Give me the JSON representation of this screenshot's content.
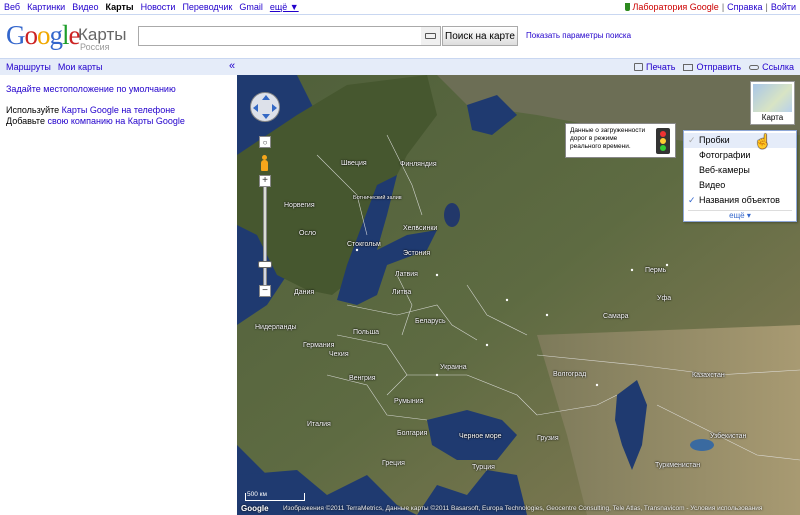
{
  "topnav": {
    "items": [
      "Веб",
      "Картинки",
      "Видео",
      "Карты",
      "Новости",
      "Переводчик",
      "Gmail",
      "ещё ▼"
    ],
    "lab": "Лаборатория Google",
    "help": "Справка",
    "signin": "Войти",
    "sep": "|"
  },
  "header": {
    "logo": "Google",
    "product": "Карты",
    "country": "Россия",
    "search_value": "",
    "search_button": "Поиск на карте",
    "search_options": "Показать параметры поиска"
  },
  "bar": {
    "routes": "Маршруты",
    "my_maps": "Мои карты",
    "collapse": "«",
    "print": "Печать",
    "send": "Отправить",
    "link": "Ссылка"
  },
  "left": {
    "set_location": "Задайте местоположение по умолчанию",
    "line1_prefix": "Используйте ",
    "line1_link": "Карты Google на телефоне",
    "line2_prefix": "Добавьте ",
    "line2_link": "свою компанию на Карты Google"
  },
  "map": {
    "type_label": "Карта",
    "zoom_center": "○",
    "zoom_in": "+",
    "zoom_out": "−",
    "traffic_tip": "Данные о загруженности дорог в режиме реального времени.",
    "menu": [
      "Пробки",
      "Фотографии",
      "Веб-камеры",
      "Видео",
      "Названия объектов"
    ],
    "menu_more": "ещё ▾",
    "scale": "500 км",
    "watermark": "Google",
    "copyright": "Изображения ©2011 TerraMetrics, Данные карты ©2011 Basarsoft, Europa Technologies, Geocentre Consulting, Tele Atlas, Transnavicom - Условия использования",
    "labels": [
      {
        "text": "Швеция"
      },
      {
        "text": "Финляндия"
      },
      {
        "text": "Норвегия"
      },
      {
        "text": "Ботнический залив"
      },
      {
        "text": "Хельсинки"
      },
      {
        "text": "Стокгольм"
      },
      {
        "text": "Осло"
      },
      {
        "text": "Эстония"
      },
      {
        "text": "Латвия"
      },
      {
        "text": "Литва"
      },
      {
        "text": "Дания"
      },
      {
        "text": "Беларусь"
      },
      {
        "text": "Польша"
      },
      {
        "text": "Германия"
      },
      {
        "text": "Нидерланды"
      },
      {
        "text": "Чехия"
      },
      {
        "text": "Украина"
      },
      {
        "text": "Венгрия"
      },
      {
        "text": "Румыния"
      },
      {
        "text": "Италия"
      },
      {
        "text": "Болгария"
      },
      {
        "text": "Черное море"
      },
      {
        "text": "Турция"
      },
      {
        "text": "Греция"
      },
      {
        "text": "Казахстан"
      },
      {
        "text": "Узбекистан"
      },
      {
        "text": "Туркменистан"
      },
      {
        "text": "Пермь"
      },
      {
        "text": "Уфа"
      },
      {
        "text": "Самара"
      },
      {
        "text": "Волгоград"
      },
      {
        "text": "Грузия"
      }
    ]
  }
}
